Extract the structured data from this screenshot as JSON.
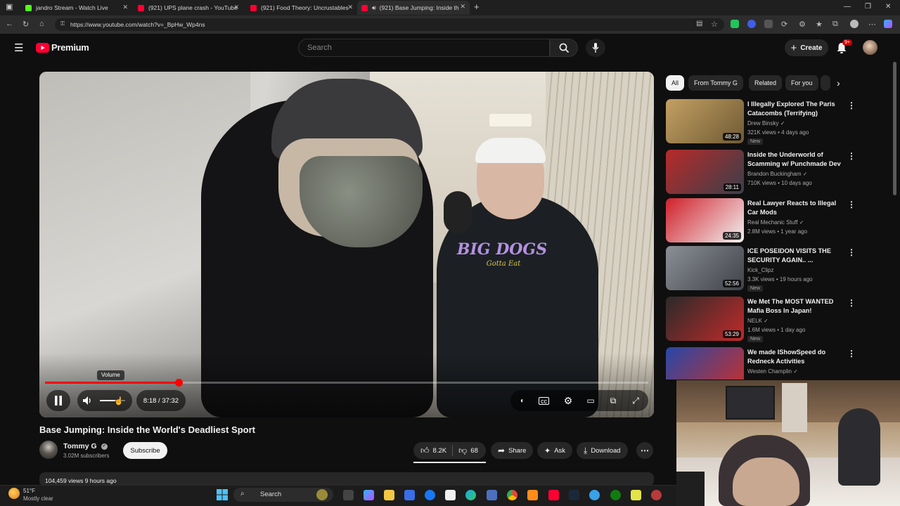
{
  "browser": {
    "tabs": [
      {
        "title": "jandro Stream - Watch Live",
        "favicon_color": "#53fc18"
      },
      {
        "title": "(921) UPS plane crash - YouTube",
        "favicon_color": "#ff0033"
      },
      {
        "title": "(921) Food Theory: Uncrustables",
        "favicon_color": "#ff0033"
      },
      {
        "title": "(921) Base Jumping: Inside th",
        "favicon_color": "#ff0033",
        "active": true
      }
    ],
    "new_tab": "+",
    "url": "https://www.youtube.com/watch?v=_BpHw_Wp4ns"
  },
  "youtube": {
    "logo_text": "Premium",
    "search_placeholder": "Search",
    "create_label": "Create",
    "notifications_badge": "9+",
    "brand_color": "#ff0033"
  },
  "player": {
    "tooltip": "Volume",
    "time": "8:18 / 37:32",
    "progress_fraction": 0.2212,
    "volume_fraction": 0.6
  },
  "video": {
    "title": "Base Jumping: Inside the World's Deadliest Sport",
    "channel": "Tommy G",
    "subscribers": "3.02M subscribers",
    "subscribe_label": "Subscribe",
    "likes": "8.2K",
    "dislikes": "68",
    "share_label": "Share",
    "ask_label": "Ask",
    "download_label": "Download",
    "views_line": "104,459 views  9 hours ago",
    "hoodie_text": "BIG DOGS",
    "hoodie_subtext": "Gotta Eat"
  },
  "chips": [
    "All",
    "From Tommy G",
    "Related",
    "For you"
  ],
  "recommendations": [
    {
      "title": "I Illegally Explored The Paris Catacombs (Terrifying)",
      "channel": "Drew Binsky",
      "meta": "321K views • 4 days ago",
      "duration": "48:28",
      "new": "New",
      "thumb": [
        "#c4a062",
        "#6e5a34"
      ]
    },
    {
      "title": "Inside the Underworld of Scamming w/ Punchmade Dev",
      "channel": "Brandon Buckingham",
      "meta": "710K views • 10 days ago",
      "duration": "28:11",
      "new": "",
      "thumb": [
        "#b82a2a",
        "#3a3f4a"
      ]
    },
    {
      "title": "Real Lawyer Reacts to Illegal Car Mods",
      "channel": "Real Mechanic Stuff",
      "meta": "2.8M views • 1 year ago",
      "duration": "24:35",
      "new": "",
      "thumb": [
        "#d0202a",
        "#f2f2f2"
      ]
    },
    {
      "title": "ICE POSEIDON VISITS THE SECURITY AGAIN.. ...",
      "channel": "Kick_Clipz",
      "meta": "3.3K views • 19 hours ago",
      "duration": "52:56",
      "new": "New",
      "thumb": [
        "#8b8f96",
        "#3f4248"
      ]
    },
    {
      "title": "We Met The MOST WANTED Mafia Boss In Japan!",
      "channel": "NELK",
      "meta": "1.6M views • 1 day ago",
      "duration": "53:29",
      "new": "New",
      "thumb": [
        "#2a2a2a",
        "#c22a2a"
      ]
    },
    {
      "title": "We made IShowSpeed do Redneck Activities",
      "channel": "Westen Champlin",
      "meta": "",
      "duration": "",
      "new": "",
      "thumb": [
        "#2548a8",
        "#c8302a"
      ]
    }
  ],
  "taskbar": {
    "weather_temp": "51°F",
    "weather_desc": "Mostly clear",
    "search_label": "Search"
  }
}
